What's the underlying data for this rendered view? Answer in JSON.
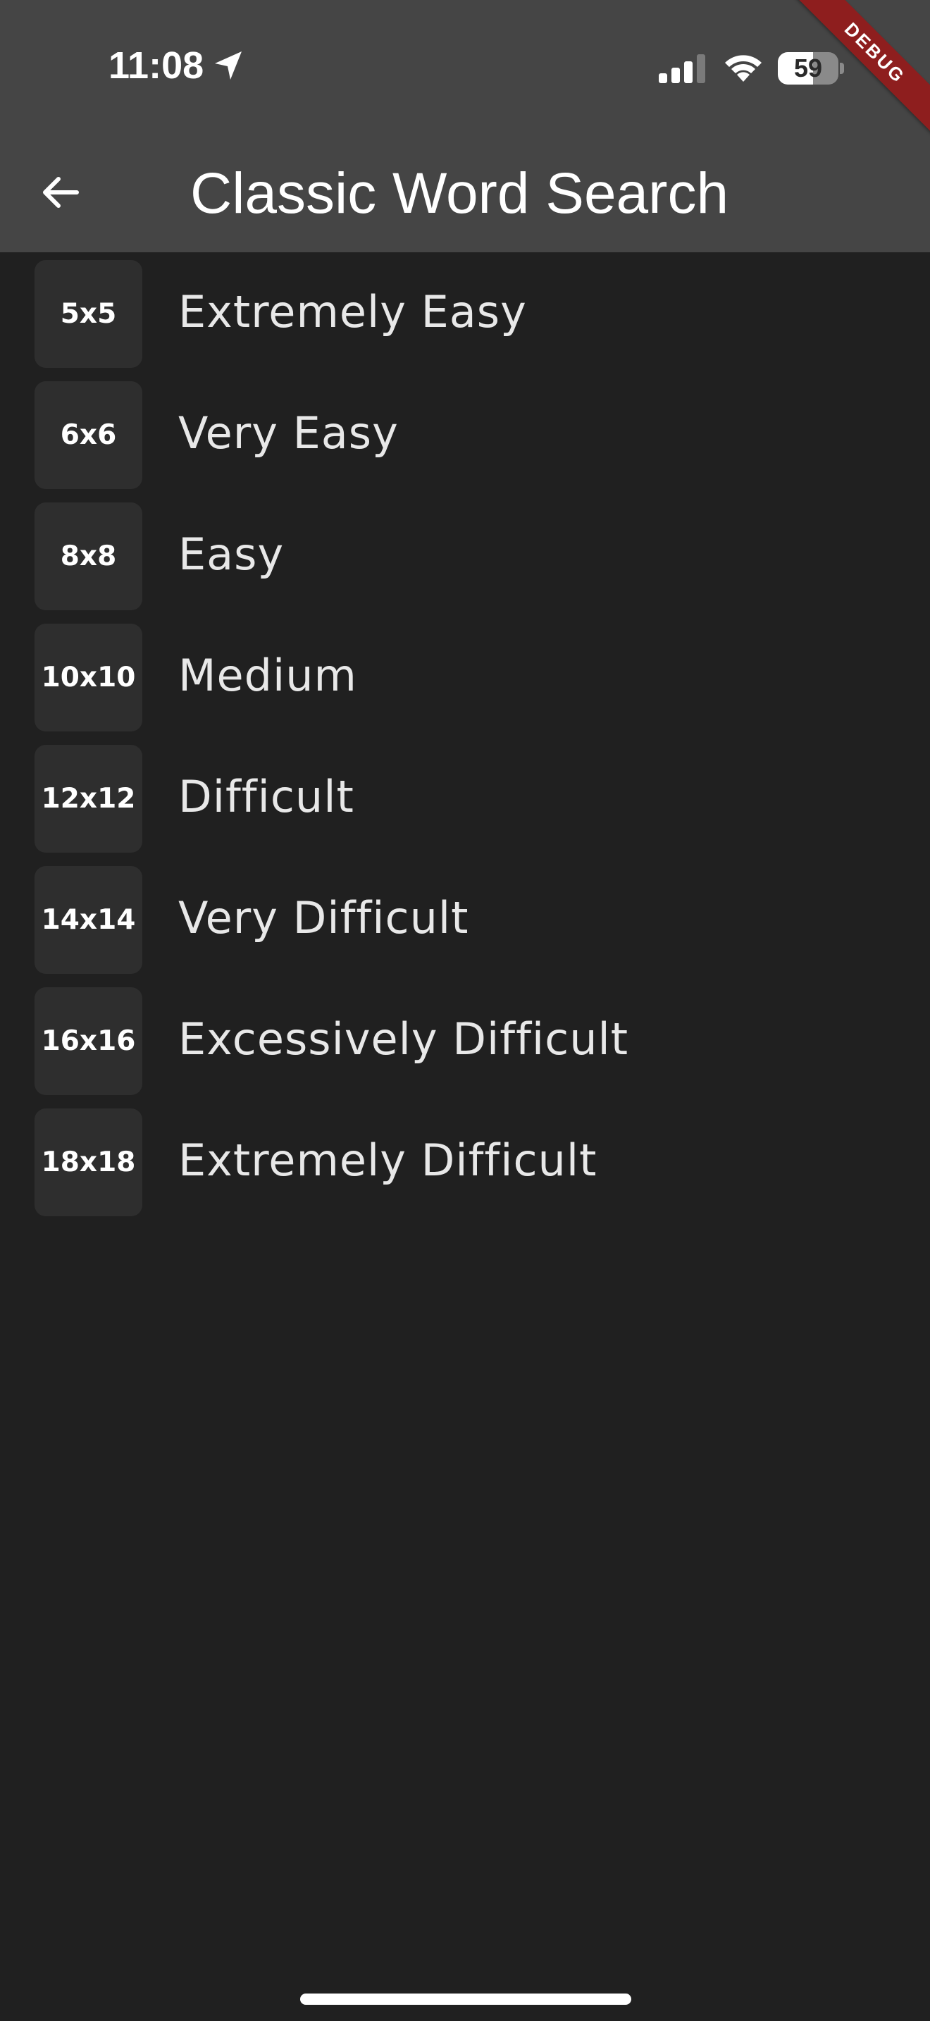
{
  "status_bar": {
    "time": "11:08",
    "battery_level": "59"
  },
  "debug_banner": "DEBUG",
  "app_bar": {
    "title": "Classic Word Search"
  },
  "levels": [
    {
      "size": "5x5",
      "label": "Extremely Easy"
    },
    {
      "size": "6x6",
      "label": "Very Easy"
    },
    {
      "size": "8x8",
      "label": "Easy"
    },
    {
      "size": "10x10",
      "label": "Medium"
    },
    {
      "size": "12x12",
      "label": "Difficult"
    },
    {
      "size": "14x14",
      "label": "Very Difficult"
    },
    {
      "size": "16x16",
      "label": "Excessively Difficult"
    },
    {
      "size": "18x18",
      "label": "Extremely Difficult"
    }
  ],
  "colors": {
    "background": "#202020",
    "app_bar": "#454545",
    "tile": "#2e2e2e",
    "debug_ribbon": "#8e1e1e"
  }
}
